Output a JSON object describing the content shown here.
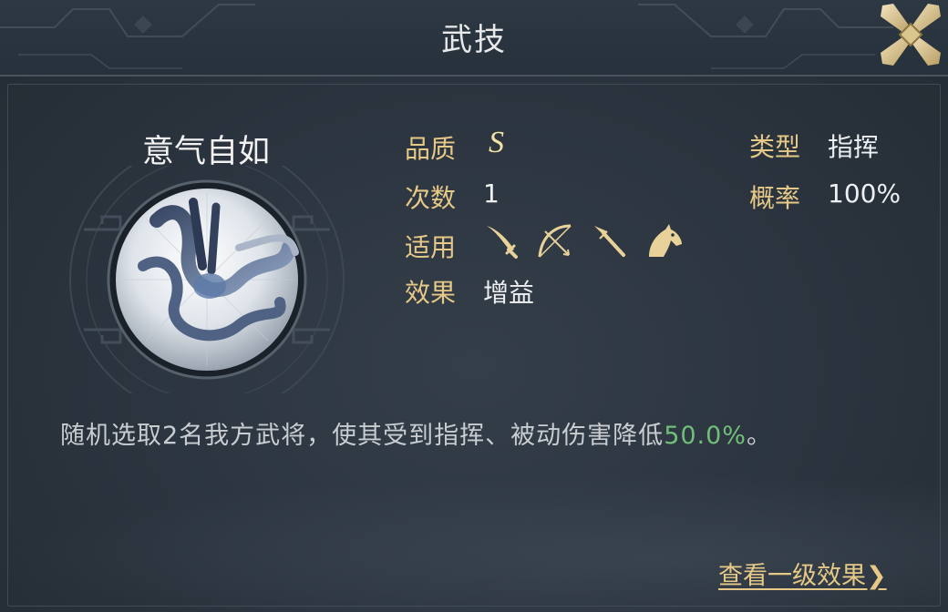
{
  "header": {
    "title": "武技"
  },
  "skill": {
    "name": "意气自如"
  },
  "attributes": {
    "quality_label": "品质",
    "quality_value": "S",
    "count_label": "次数",
    "count_value": "1",
    "applicable_label": "适用",
    "applicable_units": [
      "sword-icon",
      "bow-icon",
      "spear-icon",
      "horse-icon"
    ],
    "effect_label": "效果",
    "effect_value": "增益",
    "type_label": "类型",
    "type_value": "指挥",
    "rate_label": "概率",
    "rate_value": "100%"
  },
  "description": {
    "text": "随机选取2名我方武将，使其受到指挥、被动伤害降低",
    "highlight": "50.0%",
    "suffix": "。"
  },
  "footer": {
    "link_label": "查看一级效果",
    "link_arrow": "❯"
  },
  "colors": {
    "gold": "#e6c987",
    "highlight_green": "#6fbf79",
    "background": "#2a333d"
  }
}
